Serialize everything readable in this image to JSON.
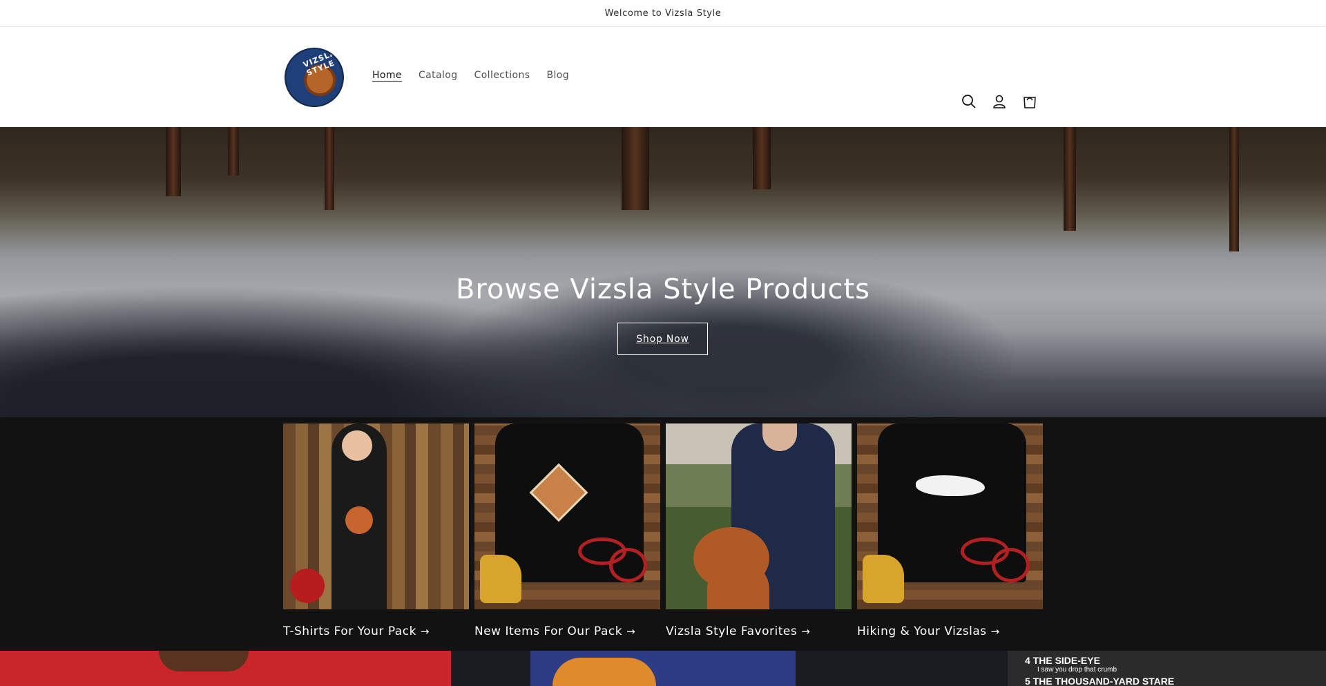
{
  "announcement": {
    "text": "Welcome to Vizsla Style"
  },
  "logo": {
    "text": "VIZSLA STYLE",
    "colors": {
      "ring": "#1f3f78",
      "dog": "#b5652a"
    }
  },
  "nav": {
    "items": [
      {
        "label": "Home",
        "active": true
      },
      {
        "label": "Catalog",
        "active": false
      },
      {
        "label": "Collections",
        "active": false
      },
      {
        "label": "Blog",
        "active": false
      }
    ]
  },
  "header_icons": [
    "search-icon",
    "account-icon",
    "cart-icon"
  ],
  "hero": {
    "title": "Browse Vizsla Style Products",
    "button_label": "Shop Now"
  },
  "collections": [
    {
      "label": "T-Shirts For Your Pack",
      "arrow": "→"
    },
    {
      "label": "New Items For Our Pack",
      "arrow": "→"
    },
    {
      "label": "Vizsla Style Favorites",
      "arrow": "→"
    },
    {
      "label": "Hiking & Your Vizslas",
      "arrow": "→"
    }
  ],
  "bottom_strip": {
    "line1": "4 THE SIDE-EYE",
    "line2": "I saw you drop that crumb",
    "line3": "5 THE THOUSAND-YARD STARE"
  },
  "colors": {
    "accent": "#121212",
    "collections_bg": "#121212",
    "white": "#ffffff"
  }
}
